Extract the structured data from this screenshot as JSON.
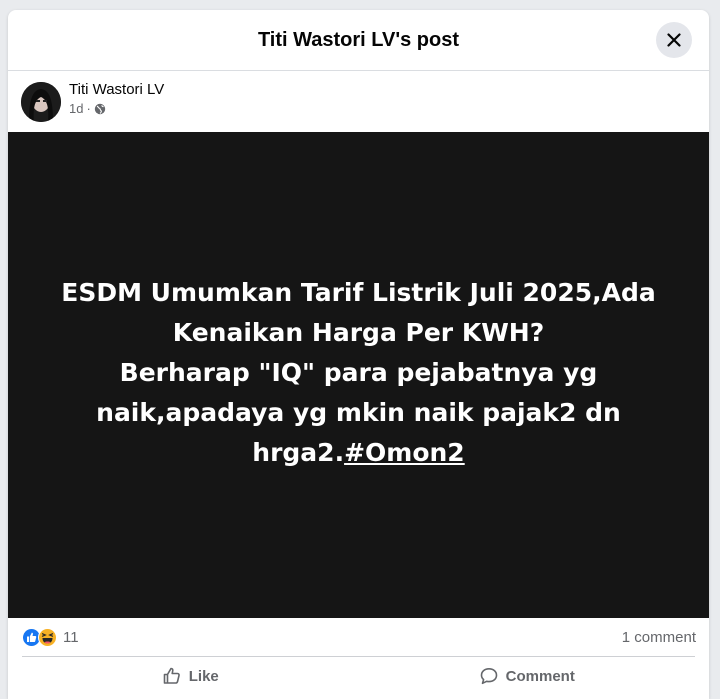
{
  "header": {
    "title": "Titi Wastori LV's post"
  },
  "author": {
    "name": "Titi Wastori LV",
    "time": "1d",
    "audience_icon": "globe-icon"
  },
  "post": {
    "lines": [
      "ESDM Umumkan Tarif Listrik Juli 2025,Ada",
      "Kenaikan Harga Per KWH?",
      "Berharap \"IQ\" para pejabatnya yg",
      "naik,apadaya yg mkin naik pajak2 dn",
      "hrga2."
    ],
    "hashtag": "#Omon2",
    "background_color": "#151515",
    "text_color": "#ffffff"
  },
  "stats": {
    "reaction_icons": [
      "like-icon",
      "haha-icon"
    ],
    "reaction_count": "11",
    "comment_count": "1 comment"
  },
  "actions": {
    "like_label": "Like",
    "comment_label": "Comment"
  },
  "colors": {
    "like_blue": "#1877f2",
    "secondary_text": "#65676b"
  }
}
